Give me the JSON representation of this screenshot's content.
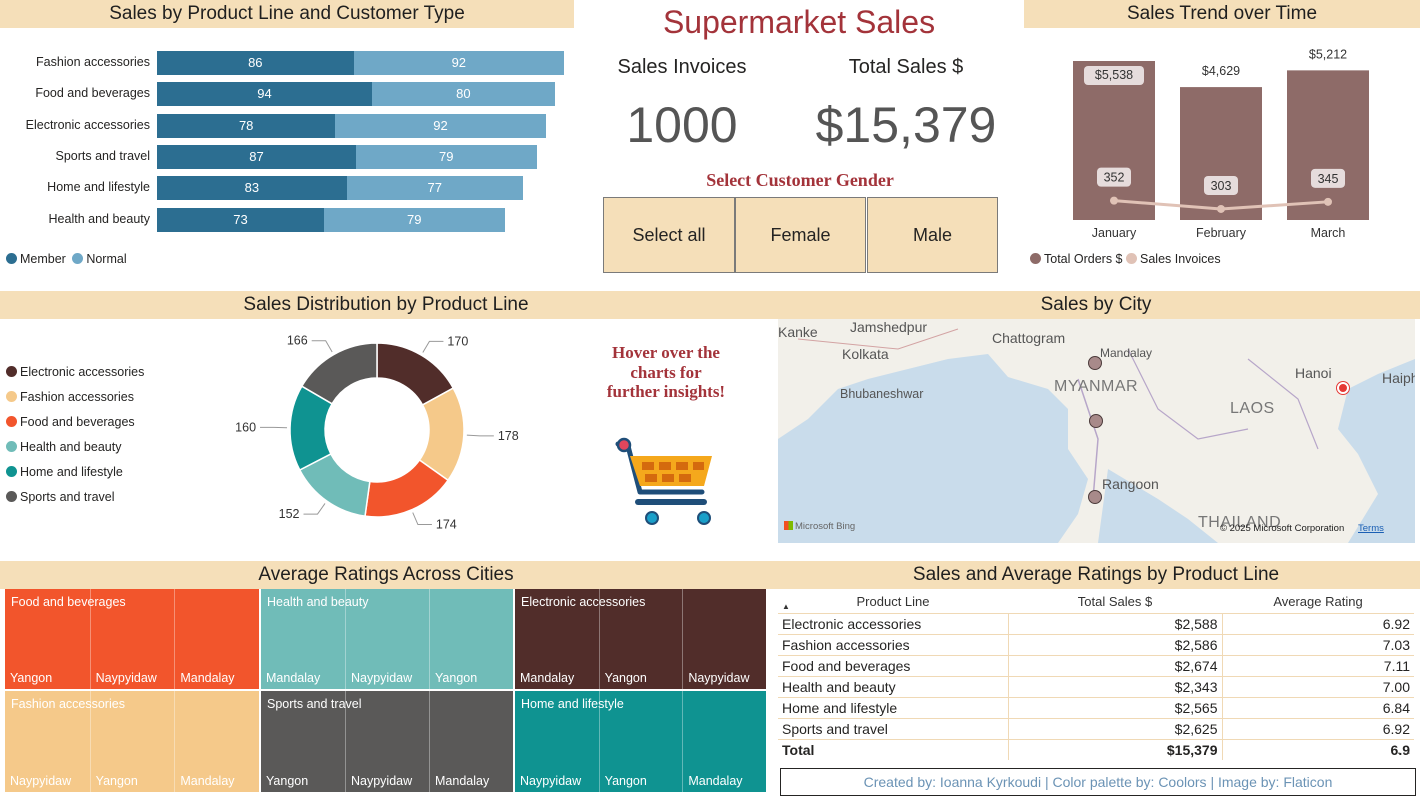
{
  "title": "Supermarket Sales",
  "colors": {
    "header_bg": "#f5dfb9",
    "member": "#2c6e91",
    "normal": "#6fa8c7",
    "title": "#a3333a",
    "brown": "#8e6b68"
  },
  "product_customer": {
    "header": "Sales by Product Line and Customer Type",
    "legend": [
      "Member",
      "Normal"
    ],
    "chart_data": {
      "type": "bar",
      "categories": [
        "Fashion accessories",
        "Food and beverages",
        "Electronic accessories",
        "Sports and travel",
        "Home and lifestyle",
        "Health and beauty"
      ],
      "series": [
        {
          "name": "Member",
          "values": [
            86,
            94,
            78,
            87,
            83,
            73
          ]
        },
        {
          "name": "Normal",
          "values": [
            92,
            80,
            92,
            79,
            77,
            79
          ]
        }
      ]
    }
  },
  "kpi": {
    "invoices_label": "Sales Invoices",
    "invoices_value": "1000",
    "sales_label": "Total Sales $",
    "sales_value": "$15,379"
  },
  "gender": {
    "title": "Select Customer Gender",
    "options": [
      "Select all",
      "Female",
      "Male"
    ]
  },
  "trend": {
    "header": "Sales Trend over Time",
    "legend": [
      "Total Orders $",
      "Sales Invoices"
    ],
    "chart_data": {
      "type": "bar",
      "categories": [
        "January",
        "February",
        "March"
      ],
      "series": [
        {
          "name": "Total Orders $",
          "values": [
            5538,
            4629,
            5212
          ],
          "labels": [
            "$5,538",
            "$4,629",
            "$5,212"
          ]
        },
        {
          "name": "Sales Invoices",
          "values": [
            352,
            303,
            345
          ]
        }
      ]
    }
  },
  "distribution": {
    "header": "Sales Distribution by Product Line",
    "chart_data": {
      "type": "pie",
      "categories": [
        "Electronic accessories",
        "Fashion accessories",
        "Food and beverages",
        "Health and beauty",
        "Home and lifestyle",
        "Sports and travel"
      ],
      "values": [
        170,
        178,
        174,
        152,
        160,
        166
      ],
      "colors": [
        "#512d2a",
        "#f5c98a",
        "#f2552c",
        "#70bcb8",
        "#0f9391",
        "#5a5958"
      ]
    },
    "hover_note": "Hover over the charts for further insights!"
  },
  "map": {
    "header": "Sales by City",
    "places": [
      "Kanke",
      "Jamshedpur",
      "Kolkata",
      "Chattogram",
      "Mandalay",
      "MYANMAR",
      "Bhubaneshwar",
      "Hanoi",
      "Haipho",
      "LAOS",
      "Rangoon",
      "THAILAND"
    ],
    "attribution": "Microsoft Bing",
    "copyright": "© 2025 Microsoft Corporation",
    "terms": "Terms"
  },
  "ratings": {
    "header": "Average Ratings Across Cities",
    "groups": [
      {
        "name": "Food and beverages",
        "color": "#f2552c",
        "cities": [
          "Yangon",
          "Naypyidaw",
          "Mandalay"
        ]
      },
      {
        "name": "Health and beauty",
        "color": "#70bcb8",
        "cities": [
          "Mandalay",
          "Naypyidaw",
          "Yangon"
        ]
      },
      {
        "name": "Electronic accessories",
        "color": "#512d2a",
        "cities": [
          "Mandalay",
          "Yangon",
          "Naypyidaw"
        ]
      },
      {
        "name": "Fashion accessories",
        "color": "#f5c98a",
        "cities": [
          "Naypyidaw",
          "Yangon",
          "Mandalay"
        ]
      },
      {
        "name": "Sports and travel",
        "color": "#5a5958",
        "cities": [
          "Yangon",
          "Naypyidaw",
          "Mandalay"
        ]
      },
      {
        "name": "Home and lifestyle",
        "color": "#0f9391",
        "cities": [
          "Naypyidaw",
          "Yangon",
          "Mandalay"
        ]
      }
    ]
  },
  "table": {
    "header": "Sales and Average Ratings by Product Line",
    "columns": [
      "Product Line",
      "Total Sales $",
      "Average Rating"
    ],
    "rows": [
      [
        "Electronic accessories",
        "$2,588",
        "6.92"
      ],
      [
        "Fashion accessories",
        "$2,586",
        "7.03"
      ],
      [
        "Food and beverages",
        "$2,674",
        "7.11"
      ],
      [
        "Health and beauty",
        "$2,343",
        "7.00"
      ],
      [
        "Home and lifestyle",
        "$2,565",
        "6.84"
      ],
      [
        "Sports and travel",
        "$2,625",
        "6.92"
      ]
    ],
    "total": [
      "Total",
      "$15,379",
      "6.9"
    ],
    "more": "..."
  },
  "credits": "Created by: Ioanna Kyrkoudi | Color palette by: Coolors | Image by: Flaticon"
}
